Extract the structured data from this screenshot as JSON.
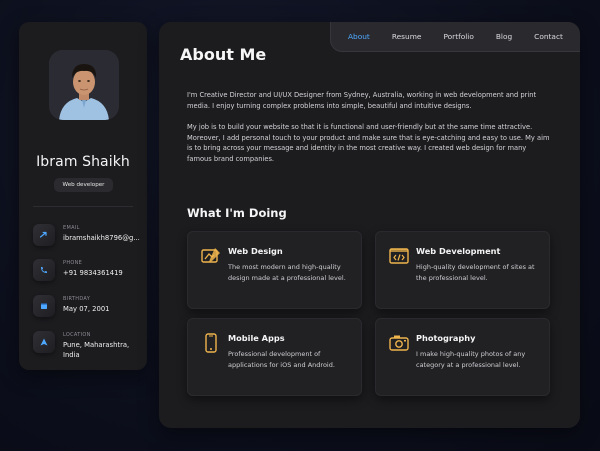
{
  "profile": {
    "name": "Ibram Shaikh",
    "role": "Web developer"
  },
  "contacts": [
    {
      "label": "EMAIL",
      "value": "ibramshaikh8796@g...",
      "icon": "mail-icon"
    },
    {
      "label": "PHONE",
      "value": "+91 9834361419",
      "icon": "phone-icon"
    },
    {
      "label": "BIRTHDAY",
      "value": "May 07, 2001",
      "icon": "calendar-icon"
    },
    {
      "label": "LOCATION",
      "value": "Pune, Maharashtra, India",
      "icon": "location-icon"
    }
  ],
  "nav": {
    "items": [
      "About",
      "Resume",
      "Portfolio",
      "Blog",
      "Contact"
    ],
    "active": "About"
  },
  "about": {
    "title": "About Me",
    "paragraph1": "I'm Creative Director and UI/UX Designer from Sydney, Australia, working in web development and print media. I enjoy turning complex problems into simple, beautiful and intuitive designs.",
    "paragraph2": "My job is to build your website so that it is functional and user-friendly but at the same time attractive. Moreover, I add personal touch to your product and make sure that is eye-catching and easy to use. My aim is to bring across your message and identity in the most creative way. I created web design for many famous brand companies."
  },
  "services": {
    "title": "What I'm Doing",
    "items": [
      {
        "title": "Web Design",
        "text": "The most modern and high-quality design made at a professional level.",
        "icon": "design-icon"
      },
      {
        "title": "Web Development",
        "text": "High-quality development of sites at the professional level.",
        "icon": "code-icon"
      },
      {
        "title": "Mobile Apps",
        "text": "Professional development of applications for iOS and Android.",
        "icon": "mobile-icon"
      },
      {
        "title": "Photography",
        "text": "I make high-quality photos of any category at a professional level.",
        "icon": "camera-icon"
      }
    ]
  },
  "colors": {
    "accent": "#f0b54c",
    "nav_active": "#4ea8ff",
    "panel": "#1c1c1f",
    "background": "#0c0f1c"
  }
}
